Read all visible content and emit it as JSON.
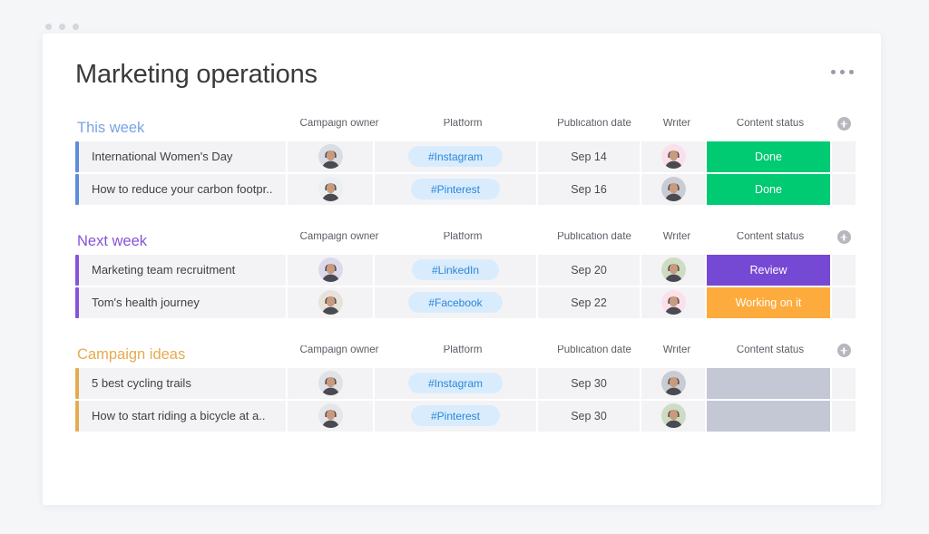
{
  "window": {
    "dots": [
      "dot-1",
      "dot-2",
      "dot-3"
    ]
  },
  "header": {
    "title": "Marketing operations",
    "menu_icon": "kebab-menu-icon"
  },
  "columns": [
    {
      "key": "name",
      "label": ""
    },
    {
      "key": "owner",
      "label": "Campaign owner"
    },
    {
      "key": "plat",
      "label": "Platform"
    },
    {
      "key": "date",
      "label": "Publication date"
    },
    {
      "key": "writer",
      "label": "Writer"
    },
    {
      "key": "status",
      "label": "Content status"
    },
    {
      "key": "add",
      "label": "add-column-icon"
    }
  ],
  "column_labels": {
    "campaign_owner": "Campaign owner",
    "platform": "Platform",
    "publication_date": "Publication date",
    "writer": "Writer",
    "content_status": "Content status"
  },
  "colors": {
    "group_blue": "#79a3e8",
    "group_purple": "#8853d8",
    "group_orange": "#e5ab50",
    "bar_blue": "#5d8ddb",
    "bar_purple": "#8853d8",
    "bar_orange": "#e5ab50",
    "status_done": "#00ca72",
    "status_review": "#7549d4",
    "status_working": "#fdab3d",
    "status_empty": "#c4c7d4",
    "tag_bg": "#d8ecfd",
    "tag_text": "#2c86d8",
    "row_bg": "#f3f3f5",
    "card_bg": "#ffffff",
    "page_bg": "#f4f6f8"
  },
  "groups": [
    {
      "title": "This week",
      "accent": "blue",
      "rows": [
        {
          "name": "International Women's Day",
          "owner_avatar": "avatar-woman-dark-hair",
          "owner_bg": "#d9dee4",
          "platform": "#Instagram",
          "date": "Sep 14",
          "writer_avatar": "avatar-woman-pink-bg",
          "writer_bg": "#fbe0ec",
          "status": "Done",
          "status_kind": "done"
        },
        {
          "name": "How to reduce your carbon footpr..",
          "owner_avatar": "avatar-man-cap",
          "owner_bg": "#eceff2",
          "platform": "#Pinterest",
          "date": "Sep 16",
          "writer_avatar": "avatar-man-beard",
          "writer_bg": "#c9ccd2",
          "status": "Done",
          "status_kind": "done"
        }
      ]
    },
    {
      "title": "Next week",
      "accent": "purple",
      "rows": [
        {
          "name": "Marketing team recruitment",
          "owner_avatar": "avatar-woman-curly-hair",
          "owner_bg": "#dcd9ec",
          "platform": "#LinkedIn",
          "date": "Sep 20",
          "writer_avatar": "avatar-woman-smiling-green-bg",
          "writer_bg": "#cfdcc4",
          "status": "Review",
          "status_kind": "review"
        },
        {
          "name": "Tom's health journey",
          "owner_avatar": "avatar-man-short-hair",
          "owner_bg": "#e7e3db",
          "platform": "#Facebook",
          "date": "Sep 22",
          "writer_avatar": "avatar-woman-pink-bg",
          "writer_bg": "#fbe0ec",
          "status": "Working on it",
          "status_kind": "working"
        }
      ]
    },
    {
      "title": "Campaign ideas",
      "accent": "orange",
      "rows": [
        {
          "name": "5 best cycling trails",
          "owner_avatar": "avatar-man-smiling",
          "owner_bg": "#dfe2e6",
          "platform": "#Instagram",
          "date": "Sep 30",
          "writer_avatar": "avatar-man-beard",
          "writer_bg": "#c9ccd2",
          "status": "",
          "status_kind": "empty"
        },
        {
          "name": "How to start riding a bicycle at a..",
          "owner_avatar": "avatar-man-dark-skin",
          "owner_bg": "#e4e6ea",
          "platform": "#Pinterest",
          "date": "Sep 30",
          "writer_avatar": "avatar-woman-smiling-green-bg",
          "writer_bg": "#cfdcc4",
          "status": "",
          "status_kind": "empty"
        }
      ]
    }
  ]
}
